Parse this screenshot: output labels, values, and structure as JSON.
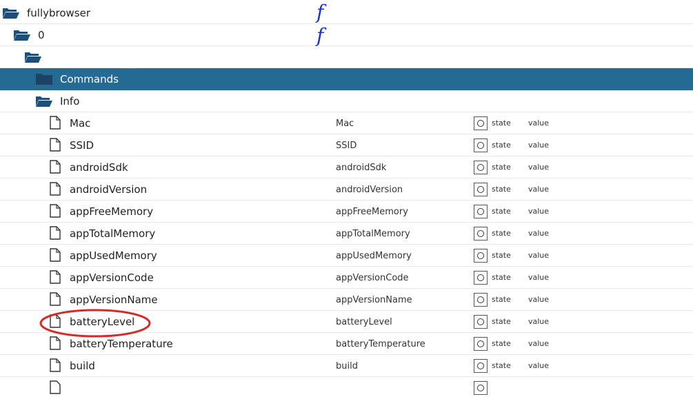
{
  "tree": {
    "root": {
      "label": "fullybrowser",
      "icon": "folder-open-icon"
    },
    "device": {
      "label": "0",
      "icon": "folder-open-icon"
    },
    "device_child": {
      "label": "",
      "icon": "folder-open-icon"
    },
    "commands": {
      "label": "Commands",
      "icon": "folder-closed-icon",
      "selected": true
    },
    "info": {
      "label": "Info",
      "icon": "folder-open-icon"
    },
    "states": [
      {
        "label": "Mac",
        "name": "Mac",
        "role": "state",
        "type": "value"
      },
      {
        "label": "SSID",
        "name": "SSID",
        "role": "state",
        "type": "value"
      },
      {
        "label": "androidSdk",
        "name": "androidSdk",
        "role": "state",
        "type": "value"
      },
      {
        "label": "androidVersion",
        "name": "androidVersion",
        "role": "state",
        "type": "value"
      },
      {
        "label": "appFreeMemory",
        "name": "appFreeMemory",
        "role": "state",
        "type": "value"
      },
      {
        "label": "appTotalMemory",
        "name": "appTotalMemory",
        "role": "state",
        "type": "value"
      },
      {
        "label": "appUsedMemory",
        "name": "appUsedMemory",
        "role": "state",
        "type": "value"
      },
      {
        "label": "appVersionCode",
        "name": "appVersionCode",
        "role": "state",
        "type": "value"
      },
      {
        "label": "appVersionName",
        "name": "appVersionName",
        "role": "state",
        "type": "value"
      },
      {
        "label": "batteryLevel",
        "name": "batteryLevel",
        "role": "state",
        "type": "value"
      },
      {
        "label": "batteryTemperature",
        "name": "batteryTemperature",
        "role": "state",
        "type": "value"
      },
      {
        "label": "build",
        "name": "build",
        "role": "state",
        "type": "value"
      }
    ]
  },
  "annotations": {
    "mark_1": "f",
    "mark_2": "f",
    "highlight_color": "#d42a2a",
    "ink_color": "#1b2fd6"
  },
  "colors": {
    "selected_row": "#256a92",
    "folder_dark": "#1f4f78",
    "row_border": "#e9e9e9"
  }
}
